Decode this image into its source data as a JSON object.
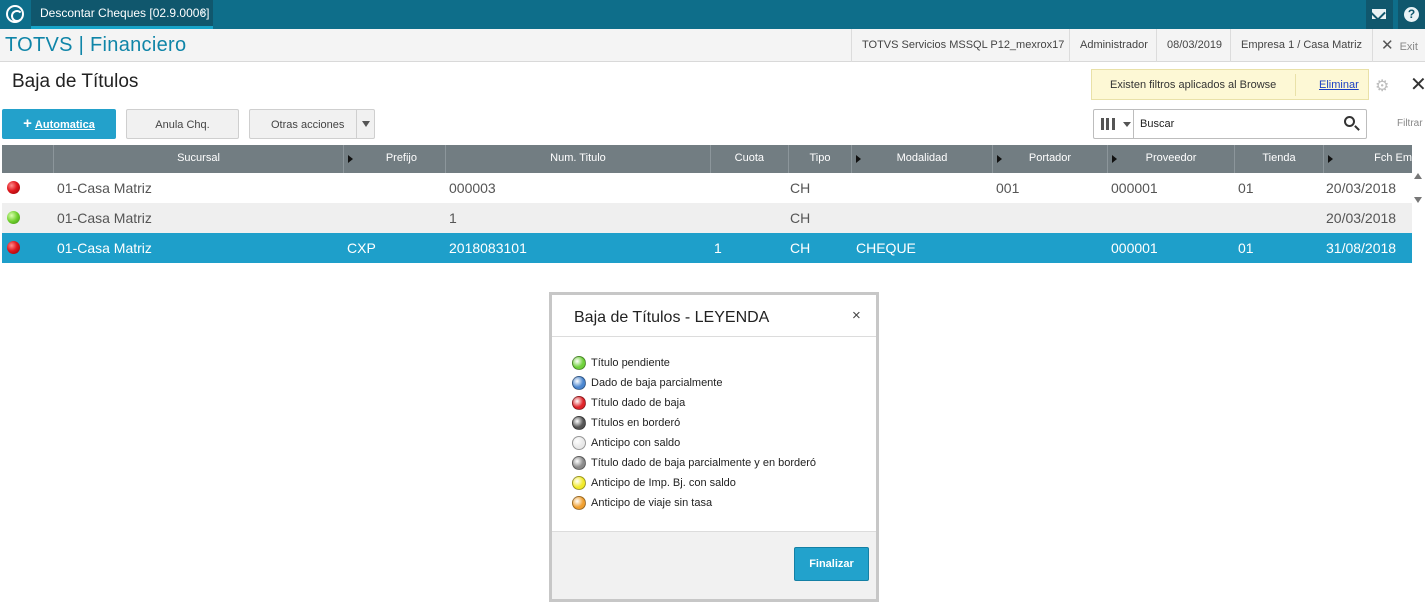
{
  "topbar": {
    "tab_label": "Descontar Cheques [02.9.0006]",
    "tab_close": "×"
  },
  "header": {
    "brand": "TOTVS | Financiero",
    "server": "TOTVS Servicios MSSQL P12_mexrox17",
    "user": "Administrador",
    "date": "08/03/2019",
    "company": "Empresa 1 / Casa Matriz",
    "exit_label": "Exit"
  },
  "page": {
    "title": "Baja de Títulos"
  },
  "filter_notice": {
    "text": "Existen filtros aplicados al Browse",
    "remove_link": "Eliminar"
  },
  "toolbar": {
    "automatica_label": "Automatica",
    "anula_label": "Anula Chq.",
    "otras_label": "Otras acciones"
  },
  "search": {
    "placeholder": "Buscar",
    "filter_label": "Filtrar"
  },
  "grid": {
    "columns": [
      "Sucursal",
      "Prefijo",
      "Num. Titulo",
      "Cuota",
      "Tipo",
      "Modalidad",
      "Portador",
      "Proveedor",
      "Tienda",
      "Fch Em"
    ],
    "rows": [
      {
        "status": "red",
        "sucursal": "01-Casa Matriz",
        "prefijo": "",
        "num_titulo": "000003",
        "cuota": "",
        "tipo": "CH",
        "modalidad": "",
        "portador": "001",
        "proveedor": "000001",
        "tienda": "01",
        "fecha": "20/03/2018"
      },
      {
        "status": "green",
        "sucursal": "01-Casa Matriz",
        "prefijo": "",
        "num_titulo": "1",
        "cuota": "",
        "tipo": "CH",
        "modalidad": "",
        "portador": "",
        "proveedor": "",
        "tienda": "",
        "fecha": "20/03/2018"
      },
      {
        "status": "red",
        "sucursal": "01-Casa Matriz",
        "prefijo": "CXP",
        "num_titulo": "2018083101",
        "cuota": "1",
        "tipo": "CH",
        "modalidad": "CHEQUE",
        "portador": "",
        "proveedor": "000001",
        "tienda": "01",
        "fecha": "31/08/2018"
      }
    ]
  },
  "modal": {
    "title": "Baja de Títulos - LEYENDA",
    "close": "×",
    "legend": [
      {
        "label": "Título pendiente",
        "color": "#6fd13a"
      },
      {
        "label": "Dado de baja parcialmente",
        "color": "#4a86d0"
      },
      {
        "label": "Título dado de baja",
        "color": "#e0252a"
      },
      {
        "label": "Títulos en borderó",
        "color": "#555555"
      },
      {
        "label": "Anticipo con saldo",
        "color": "#e8e8e8"
      },
      {
        "label": "Título dado de baja parcialmente y en borderó",
        "color": "#8a8a8a"
      },
      {
        "label": "Anticipo de Imp. Bj. con saldo",
        "color": "#f2ea2a"
      },
      {
        "label": "Anticipo de viaje sin tasa",
        "color": "#f0a030"
      }
    ],
    "finalizar_label": "Finalizar"
  }
}
